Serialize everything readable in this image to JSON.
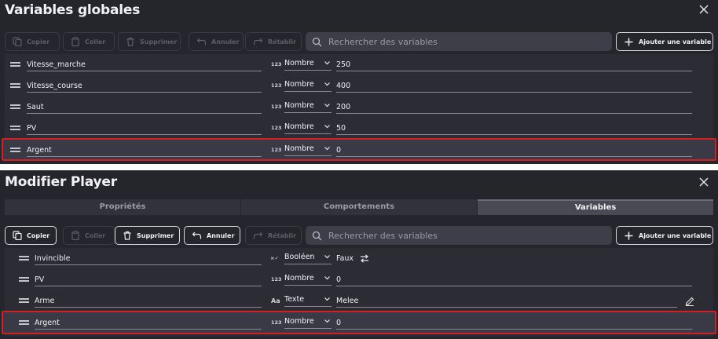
{
  "panel1": {
    "title": "Variables globales",
    "toolbar": {
      "copy": "Copier",
      "paste": "Coller",
      "delete": "Supprimer",
      "undo": "Annuler",
      "redo": "Rétablir",
      "search_placeholder": "Rechercher des variables",
      "add": "Ajouter une variable"
    },
    "rows": [
      {
        "name": "Vitesse_marche",
        "type_icon": "123",
        "type": "Nombre",
        "value": "250"
      },
      {
        "name": "Vitesse_course",
        "type_icon": "123",
        "type": "Nombre",
        "value": "400"
      },
      {
        "name": "Saut",
        "type_icon": "123",
        "type": "Nombre",
        "value": "200"
      },
      {
        "name": "PV",
        "type_icon": "123",
        "type": "Nombre",
        "value": "50"
      },
      {
        "name": "Argent",
        "type_icon": "123",
        "type": "Nombre",
        "value": "0"
      }
    ]
  },
  "panel2": {
    "title": "Modifier Player",
    "tabs": [
      "Propriétés",
      "Comportements",
      "Variables"
    ],
    "active_tab": "Variables",
    "toolbar": {
      "copy": "Copier",
      "paste": "Coller",
      "delete": "Supprimer",
      "undo": "Annuler",
      "redo": "Rétablir",
      "search_placeholder": "Rechercher des variables",
      "add": "Ajouter une variable"
    },
    "rows": [
      {
        "name": "Invincible",
        "type_icon": "×✓",
        "type": "Booléen",
        "value": "Faux"
      },
      {
        "name": "PV",
        "type_icon": "123",
        "type": "Nombre",
        "value": "0"
      },
      {
        "name": "Arme",
        "type_icon": "Aa",
        "type": "Texte",
        "value": "Melee"
      },
      {
        "name": "Argent",
        "type_icon": "123",
        "type": "Nombre",
        "value": "0"
      }
    ]
  },
  "colors": {
    "panel_bg": "#25252c",
    "list_bg": "#2c2c35",
    "selection_border": "#d21f26",
    "search_bg": "#3e3e48"
  },
  "icons": [
    "close-icon",
    "copy-icon",
    "paste-icon",
    "trash-icon",
    "undo-icon",
    "redo-icon",
    "search-icon",
    "plus-icon",
    "drag-handle-icon",
    "chevron-down-icon",
    "swap-icon",
    "edit-icon"
  ]
}
